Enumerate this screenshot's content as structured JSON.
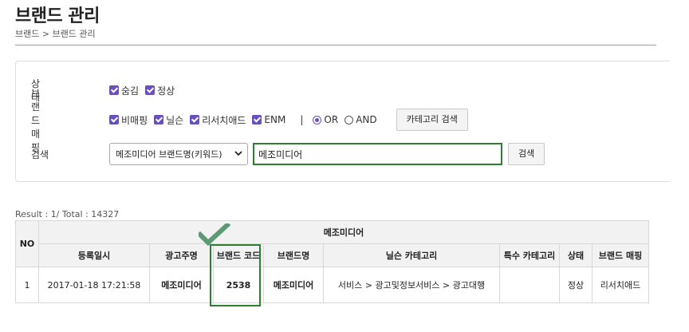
{
  "page": {
    "title": "브랜드 관리",
    "breadcrumb": "브랜드 > 브랜드 관리"
  },
  "filters": {
    "status": {
      "label": "상태",
      "options": [
        {
          "label": "숨김",
          "checked": true
        },
        {
          "label": "정상",
          "checked": true
        }
      ]
    },
    "mapping": {
      "label": "브랜드 매핑",
      "options": [
        {
          "label": "비매핑",
          "checked": true
        },
        {
          "label": "닐슨",
          "checked": true
        },
        {
          "label": "리서치애드",
          "checked": true
        },
        {
          "label": "ENM",
          "checked": true
        }
      ],
      "separator": "|",
      "logic": [
        {
          "label": "OR",
          "selected": true
        },
        {
          "label": "AND",
          "selected": false
        }
      ],
      "category_search_label": "카테고리 검색"
    },
    "search": {
      "label": "검색",
      "select_value": "메조미디어 브랜드명(키워드)",
      "input_value": "메조미디어",
      "button_label": "검색"
    }
  },
  "result": {
    "summary": "Result : 1/ Total : 14327"
  },
  "table": {
    "group_header": "메조미디어",
    "no_header": "NO",
    "columns": [
      "등록일시",
      "광고주명",
      "브랜드 코드",
      "브랜드명",
      "닐슨 카테고리",
      "특수 카테고리",
      "상태",
      "브랜드 매핑"
    ],
    "rows": [
      {
        "no": "1",
        "date": "2017-01-18 17:21:58",
        "advertiser": "메조미디어",
        "code": "2538",
        "brand": "메조미디어",
        "nielsen": "서비스 > 광고및정보서비스 > 광고대행",
        "special": "",
        "status": "정상",
        "mapping": "리서치애드"
      }
    ]
  },
  "colors": {
    "accent": "#6a4fbf",
    "highlight": "#2e7d32",
    "check": "#5c9a74"
  }
}
